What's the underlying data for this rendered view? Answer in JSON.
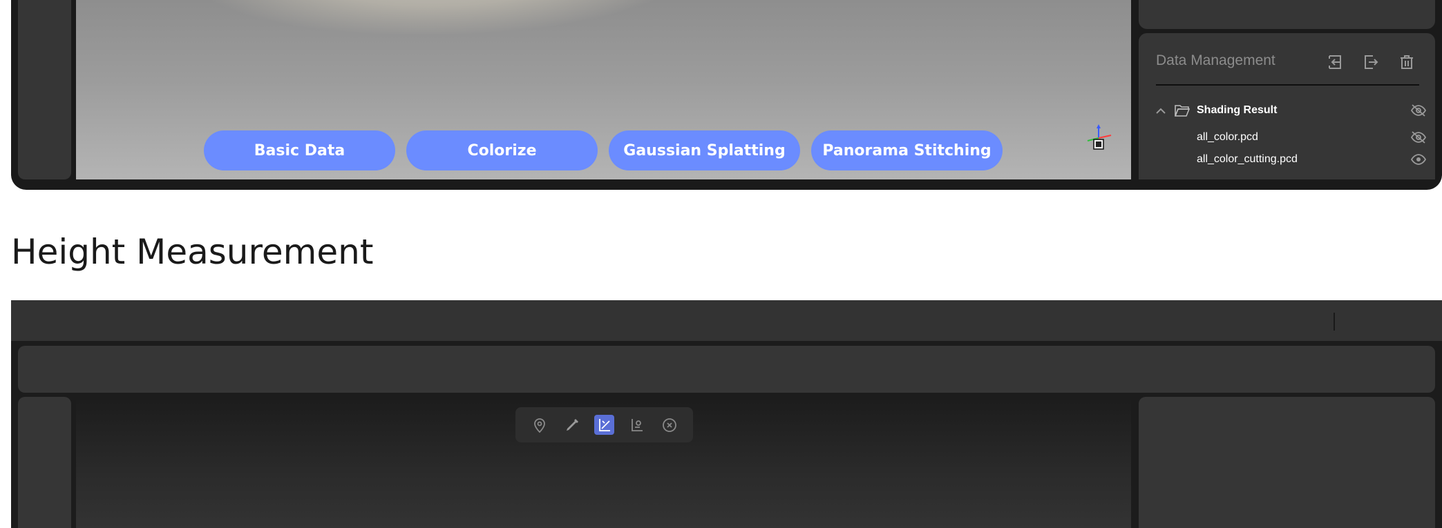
{
  "top_app": {
    "modes": [
      {
        "label": "Basic Data"
      },
      {
        "label": "Colorize"
      },
      {
        "label": "Gaussian Splatting"
      },
      {
        "label": "Panorama Stitching"
      }
    ],
    "data_management": {
      "title": "Data Management",
      "actions": [
        "import-icon",
        "export-icon",
        "trash-icon"
      ],
      "folder": {
        "name": "Shading Result",
        "expanded": true,
        "visible": false
      },
      "files": [
        {
          "name": "all_color.pcd",
          "visible": false
        },
        {
          "name": "all_color_cutting.pcd",
          "visible": true
        }
      ]
    }
  },
  "section": {
    "title": "Height Measurement"
  },
  "bottom_app": {
    "measure_tools": [
      {
        "icon": "location-pin-icon",
        "active": false
      },
      {
        "icon": "ruler-pencil-icon",
        "active": false
      },
      {
        "icon": "height-measure-icon",
        "active": true
      },
      {
        "icon": "area-measure-icon",
        "active": false
      },
      {
        "icon": "close-circle-icon",
        "active": false
      }
    ]
  },
  "colors": {
    "accent": "#6b8cff",
    "active_tool": "#5a6fd6",
    "panel": "#363636",
    "frame": "#1a1a1a"
  }
}
